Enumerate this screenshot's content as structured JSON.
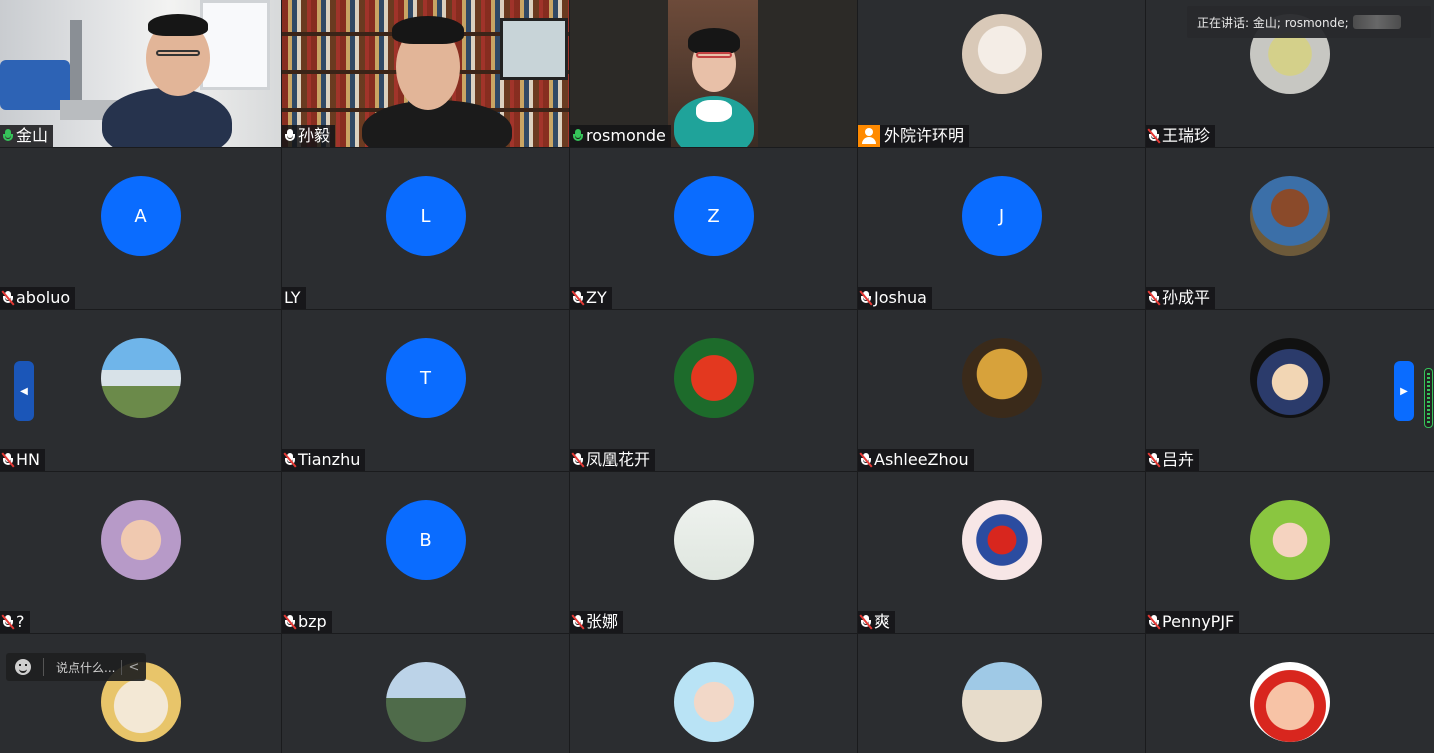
{
  "speaking_banner": {
    "text": "正在讲话: 金山; rosmonde;"
  },
  "chat": {
    "placeholder": "说点什么..."
  },
  "colors": {
    "letter_avatar": "#0a6cff",
    "speaking_outline": "#36c45a",
    "muted": "#e53935"
  },
  "participants": [
    {
      "name": "金山",
      "mic": "active",
      "avatar": "video"
    },
    {
      "name": "孙毅",
      "mic": "on",
      "avatar": "video"
    },
    {
      "name": "rosmonde",
      "mic": "active",
      "avatar": "video"
    },
    {
      "name": "外院许环明",
      "mic": "phone",
      "avatar": "photo"
    },
    {
      "name": "王瑞珍",
      "mic": "muted",
      "avatar": "photo"
    },
    {
      "name": "aboluo",
      "mic": "muted",
      "avatar": "letter",
      "letter": "A"
    },
    {
      "name": "LY",
      "mic": "none",
      "avatar": "letter",
      "letter": "L"
    },
    {
      "name": "ZY",
      "mic": "muted",
      "avatar": "letter",
      "letter": "Z"
    },
    {
      "name": "Joshua",
      "mic": "muted",
      "avatar": "letter",
      "letter": "J"
    },
    {
      "name": "孙成平",
      "mic": "muted",
      "avatar": "photo"
    },
    {
      "name": "HN",
      "mic": "muted",
      "avatar": "photo"
    },
    {
      "name": "Tianzhu",
      "mic": "muted",
      "avatar": "letter",
      "letter": "T"
    },
    {
      "name": "凤凰花开",
      "mic": "muted",
      "avatar": "photo"
    },
    {
      "name": "AshleeZhou",
      "mic": "muted",
      "avatar": "photo"
    },
    {
      "name": "吕卉",
      "mic": "muted",
      "avatar": "photo"
    },
    {
      "name": "?",
      "mic": "muted",
      "avatar": "photo"
    },
    {
      "name": "bzp",
      "mic": "muted",
      "avatar": "letter",
      "letter": "B"
    },
    {
      "name": "张娜",
      "mic": "muted",
      "avatar": "photo"
    },
    {
      "name": "爽",
      "mic": "muted",
      "avatar": "photo"
    },
    {
      "name": "PennyPJF",
      "mic": "muted",
      "avatar": "photo"
    },
    {
      "name": "",
      "mic": "none",
      "avatar": "photo"
    },
    {
      "name": "",
      "mic": "none",
      "avatar": "photo"
    },
    {
      "name": "",
      "mic": "none",
      "avatar": "photo"
    },
    {
      "name": "",
      "mic": "none",
      "avatar": "photo"
    },
    {
      "name": "",
      "mic": "none",
      "avatar": "photo"
    }
  ]
}
